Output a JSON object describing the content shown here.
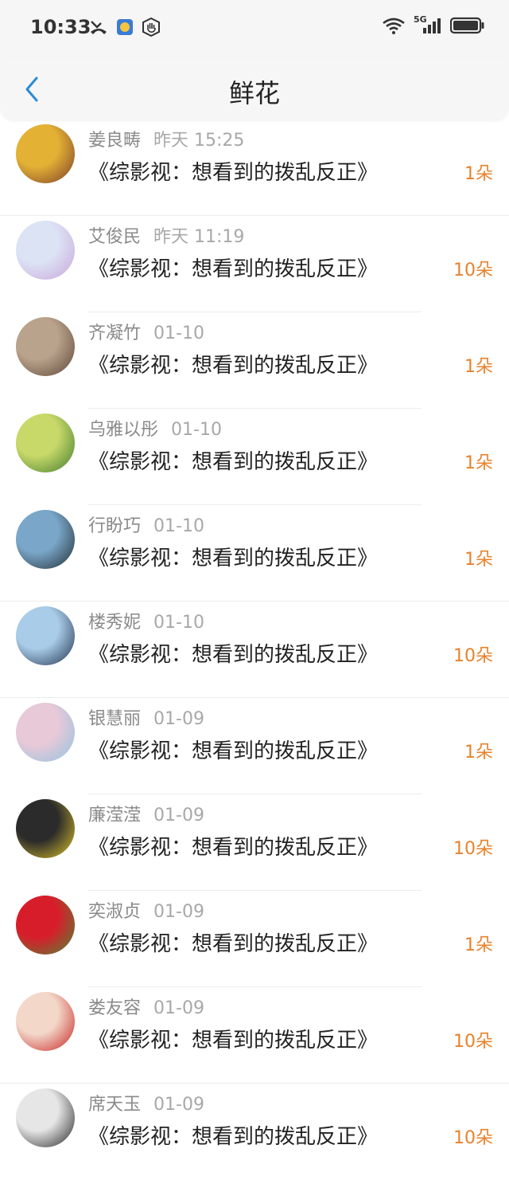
{
  "status_bar": {
    "time": "10:33",
    "network": "5G"
  },
  "header": {
    "title": "鲜花"
  },
  "items": [
    {
      "name": "姜良畴",
      "time": "昨天 15:25",
      "book": "《综影视：想看到的拨乱反正》",
      "count": "1朵",
      "avatar_colors": [
        "#e3b235",
        "#7b3b2a"
      ],
      "sep": "full"
    },
    {
      "name": "艾俊民",
      "time": "昨天 11:19",
      "book": "《综影视：想看到的拨乱反正》",
      "count": "10朵",
      "avatar_colors": [
        "#dce3f5",
        "#c9a4d8"
      ],
      "sep": "short"
    },
    {
      "name": "齐凝竹",
      "time": "01-10",
      "book": "《综影视：想看到的拨乱反正》",
      "count": "1朵",
      "avatar_colors": [
        "#b9a38c",
        "#5b4536"
      ],
      "sep": "short"
    },
    {
      "name": "乌雅以彤",
      "time": "01-10",
      "book": "《综影视：想看到的拨乱反正》",
      "count": "1朵",
      "avatar_colors": [
        "#c8d96a",
        "#3f7a2c"
      ],
      "sep": "short"
    },
    {
      "name": "行盼巧",
      "time": "01-10",
      "book": "《综影视：想看到的拨乱反正》",
      "count": "1朵",
      "avatar_colors": [
        "#7aa7c9",
        "#1f2b33"
      ],
      "sep": "full"
    },
    {
      "name": "楼秀妮",
      "time": "01-10",
      "book": "《综影视：想看到的拨乱反正》",
      "count": "10朵",
      "avatar_colors": [
        "#a9cde8",
        "#1f2e4a"
      ],
      "sep": "full"
    },
    {
      "name": "银慧丽",
      "time": "01-09",
      "book": "《综影视：想看到的拨乱反正》",
      "count": "1朵",
      "avatar_colors": [
        "#e8c9d8",
        "#8fc3e0"
      ],
      "sep": "short"
    },
    {
      "name": "廉滢滢",
      "time": "01-09",
      "book": "《综影视：想看到的拨乱反正》",
      "count": "10朵",
      "avatar_colors": [
        "#2b2b2b",
        "#e0c62a"
      ],
      "sep": "short"
    },
    {
      "name": "奕淑贞",
      "time": "01-09",
      "book": "《综影视：想看到的拨乱反正》",
      "count": "1朵",
      "avatar_colors": [
        "#d81d2a",
        "#4d8a35"
      ],
      "sep": "short"
    },
    {
      "name": "娄友容",
      "time": "01-09",
      "book": "《综影视：想看到的拨乱反正》",
      "count": "10朵",
      "avatar_colors": [
        "#f3d7c9",
        "#c62020"
      ],
      "sep": "full"
    },
    {
      "name": "席天玉",
      "time": "01-09",
      "book": "《综影视：想看到的拨乱反正》",
      "count": "10朵",
      "avatar_colors": [
        "#e6e6e6",
        "#222222"
      ],
      "sep": "none"
    }
  ],
  "colors": {
    "accent": "#2a8bd8",
    "count": "#e8822c"
  }
}
